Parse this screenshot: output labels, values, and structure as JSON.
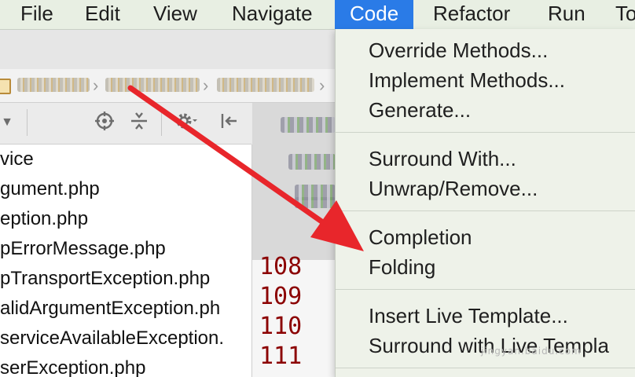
{
  "menubar": {
    "items": [
      {
        "label": "File"
      },
      {
        "label": "Edit"
      },
      {
        "label": "View"
      },
      {
        "label": "Navigate"
      },
      {
        "label": "Code"
      },
      {
        "label": "Refactor"
      },
      {
        "label": "Run"
      },
      {
        "label": "To"
      }
    ],
    "active_item": "Code",
    "active_color": "#2a7be7"
  },
  "file_list": {
    "items": [
      "vice",
      "gument.php",
      "eption.php",
      "pErrorMessage.php",
      "pTransportException.php",
      "alidArgumentException.ph",
      "serviceAvailableException.",
      "serException.php"
    ]
  },
  "editor": {
    "line_numbers": [
      "108",
      "109",
      "110",
      "111"
    ],
    "line_number_color": "#8b0000"
  },
  "toolbar": {
    "icons": [
      "dropdown-arrow-icon",
      "crosshair-icon",
      "collapse-icon",
      "gear-icon",
      "pin-left-icon"
    ]
  },
  "code_menu": {
    "groups": [
      [
        "Override Methods...",
        "Implement Methods...",
        "Generate..."
      ],
      [
        "Surround With...",
        "Unwrap/Remove..."
      ],
      [
        "Completion",
        "Folding"
      ],
      [
        "Insert Live Template...",
        "Surround with Live Templa"
      ]
    ]
  },
  "annotation": {
    "arrow_color": "#e8262b"
  },
  "watermark": "jingyan.baidu.com"
}
